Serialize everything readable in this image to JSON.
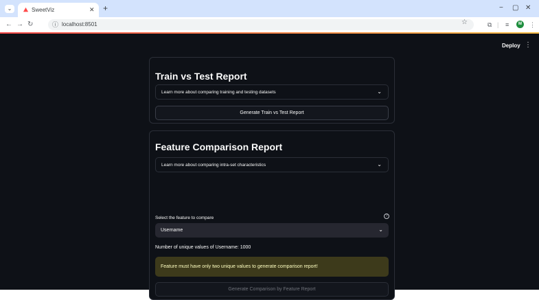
{
  "browser": {
    "tab_title": "SweetViz",
    "url": "localhost:8501",
    "window_controls": [
      "−",
      "▢",
      "✕"
    ]
  },
  "app": {
    "deploy_label": "Deploy",
    "menu_icon": "⋮",
    "accent_colors": [
      "#ff4b4b",
      "#ffbd45"
    ],
    "train_test": {
      "heading": "Train vs Test Report",
      "expander_label": "Learn more about comparing training and testing datasets",
      "button_label": "Generate Train vs Test Report"
    },
    "feature_comparison": {
      "heading": "Feature Comparison Report",
      "expander_label": "Learn more about comparing intra-set characteristics",
      "select_label": "Select the feature to compare",
      "selected_feature": "Username",
      "unique_values_text": "Number of unique values of Username: 1000",
      "warning_text": "Feature must have only two unique values to generate comparison report!",
      "button_label": "Generate Comparison by Feature Report",
      "warning_color": "#3d3a1b"
    }
  }
}
